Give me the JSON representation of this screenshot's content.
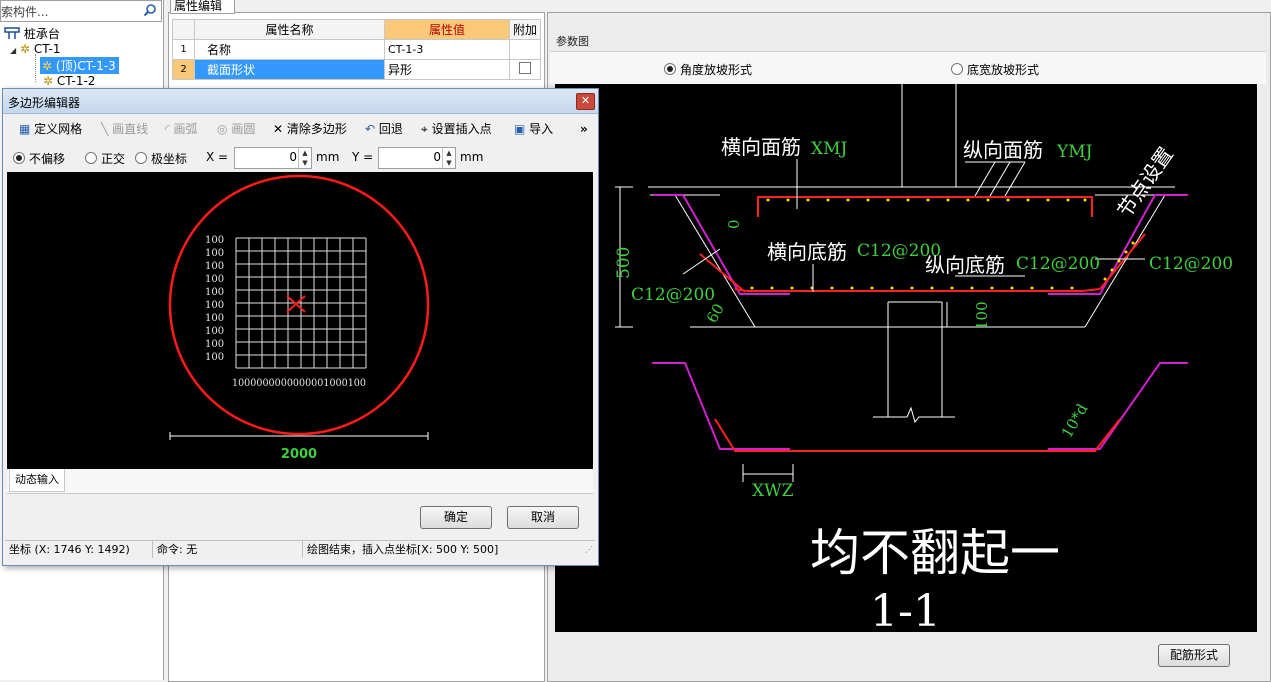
{
  "left_pane": {
    "search_placeholder": "搜索构件...",
    "tree": {
      "root": "桩承台",
      "group": "CT-1",
      "item_selected": "(顶)CT-1-3",
      "item2": "CT-1-2"
    }
  },
  "prop_editor": {
    "tab_label": "属性编辑",
    "headers": {
      "num": "",
      "name": "属性名称",
      "value": "属性值",
      "extra": "附加"
    },
    "rows": [
      {
        "num": "1",
        "name": "名称",
        "value": "CT-1-3"
      },
      {
        "num": "2",
        "name": "截面形状",
        "value": "异形"
      }
    ]
  },
  "param_panel": {
    "title": "参数图",
    "radio_angle": "角度放坡形式",
    "radio_bottom": "底宽放坡形式",
    "rebar_button": "配筋形式",
    "drawing": {
      "heng_mian": "横向面筋",
      "xmj": "XMJ",
      "zong_mian": "纵向面筋",
      "ymj": "YMJ",
      "node_setting": "节点设置",
      "heng_di": "横向底筋",
      "c12_1": "C12@200",
      "zong_di": "纵向底筋",
      "c12_2": "C12@200",
      "c12_3": "C12@200",
      "c12_left": "C12@200",
      "dim_500": "500",
      "dim_0": "0",
      "dim_100": "100",
      "angle_60": "60",
      "dim_10d": "10*d",
      "xwz": "XWZ",
      "note": "均不翻起一",
      "section": "1-1"
    }
  },
  "dialog": {
    "title": "多边形编辑器",
    "toolbar": {
      "define_grid": "定义网格",
      "draw_line": "画直线",
      "draw_arc": "画弧",
      "draw_circle": "画圆",
      "clear_polygon": "清除多边形",
      "undo": "回退",
      "set_insert_point": "设置插入点",
      "import": "导入",
      "more": "»"
    },
    "snap": {
      "no_offset": "不偏移",
      "ortho": "正交",
      "polar": "极坐标",
      "x_label": "X =",
      "x_value": "0",
      "x_unit": "mm",
      "y_label": "Y =",
      "y_value": "0",
      "y_unit": "mm"
    },
    "canvas": {
      "grid_label": "100",
      "x_labels": "1000000000000001000100",
      "diameter": "2000"
    },
    "dynamic_input_tab": "动态输入",
    "ok": "确定",
    "cancel": "取消",
    "status": {
      "coords": "坐标 (X: 1746 Y: 1492)",
      "command": "命令: 无",
      "message": "绘图结束，插入点坐标[X: 500 Y: 500]"
    }
  }
}
